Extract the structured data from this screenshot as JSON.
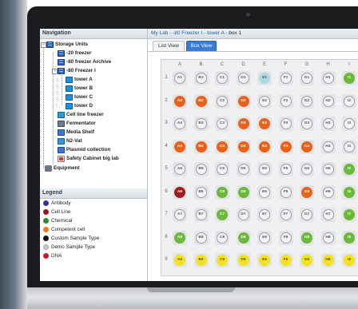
{
  "nav": {
    "header": "Navigation",
    "tree": [
      {
        "label": "Storage Units",
        "icon": "storage-units-icon",
        "type": "freezer"
      },
      {
        "label": "-20 freezer",
        "icon": "freezer-icon",
        "type": "freezer"
      },
      {
        "label": "-80 freezer Archive",
        "icon": "freezer-icon",
        "type": "freezer"
      },
      {
        "label": "-80 Freezer I",
        "icon": "freezer-icon",
        "type": "freezer"
      },
      {
        "label": "tower A",
        "icon": "tower-icon",
        "type": "tower"
      },
      {
        "label": "tower B",
        "icon": "tower-icon",
        "type": "tower"
      },
      {
        "label": "tower C",
        "icon": "tower-icon",
        "type": "tower"
      },
      {
        "label": "tower D",
        "icon": "tower-icon",
        "type": "tower"
      },
      {
        "label": "Cell line freezer",
        "icon": "freezer-icon",
        "type": "nitro"
      },
      {
        "label": "Fermentator",
        "icon": "fermentator-icon",
        "type": "ferm"
      },
      {
        "label": "Media Shelf",
        "icon": "shelf-icon",
        "type": "shelf"
      },
      {
        "label": "N2-Vat",
        "icon": "nitrogen-vat-icon",
        "type": "nitro"
      },
      {
        "label": "Plasmid collection",
        "icon": "freezer-icon",
        "type": "shelf"
      },
      {
        "label": "Safety Cabinet big lab",
        "icon": "cabinet-icon",
        "type": "cabinet"
      },
      {
        "label": "Equipment",
        "icon": "equipment-icon",
        "type": "gear"
      }
    ]
  },
  "legend": {
    "header": "Legend",
    "items": [
      {
        "label": "Antibody",
        "color": "#3b2f8f"
      },
      {
        "label": "Cell Line",
        "color": "#8f1c1c"
      },
      {
        "label": "Chemical",
        "color": "#2f8a2f"
      },
      {
        "label": "Competent cell",
        "color": "#f07a1a"
      },
      {
        "label": "Custom Sample Type",
        "color": "#111111"
      },
      {
        "label": "Demo Sample Type",
        "color": "#c9c9c9"
      },
      {
        "label": "DNA",
        "color": "#b8222a"
      }
    ]
  },
  "breadcrumb": {
    "items": [
      "My Lab",
      "-80 Freezer I",
      "tower A"
    ],
    "separator": "-",
    "current": "box 1"
  },
  "tabs": [
    {
      "label": "List View",
      "active": false
    },
    {
      "label": "Box View",
      "active": true
    }
  ],
  "box": {
    "columns": [
      "A",
      "B",
      "C",
      "D",
      "E",
      "F",
      "G",
      "H",
      "I"
    ],
    "rows": [
      "1",
      "2",
      "3",
      "4",
      "5",
      "6",
      "7",
      "8",
      "9"
    ],
    "well_colors": {
      "empty": "#f2f3f4",
      "orange": "#e8621c",
      "green": "#6cb83a",
      "red": "#a11d1d",
      "yellow": "#f3e21c",
      "teal": "#a8dbe6"
    },
    "wells": [
      [
        {
          "l": "A1",
          "c": "empty"
        },
        {
          "l": "B1",
          "c": "empty"
        },
        {
          "l": "C1",
          "c": "empty"
        },
        {
          "l": "D1",
          "c": "empty"
        },
        {
          "l": "E1",
          "c": "teal"
        },
        {
          "l": "F1",
          "c": "empty"
        },
        {
          "l": "G1",
          "c": "empty"
        },
        {
          "l": "H1",
          "c": "empty"
        },
        {
          "l": "I1",
          "c": "green"
        }
      ],
      [
        {
          "l": "A2",
          "c": "orange"
        },
        {
          "l": "B2",
          "c": "orange"
        },
        {
          "l": "C2",
          "c": "empty"
        },
        {
          "l": "D2",
          "c": "orange"
        },
        {
          "l": "E2",
          "c": "empty"
        },
        {
          "l": "F2",
          "c": "empty"
        },
        {
          "l": "G2",
          "c": "empty"
        },
        {
          "l": "H2",
          "c": "empty"
        },
        {
          "l": "I2",
          "c": "empty"
        }
      ],
      [
        {
          "l": "A3",
          "c": "empty"
        },
        {
          "l": "B3",
          "c": "empty"
        },
        {
          "l": "C3",
          "c": "empty"
        },
        {
          "l": "D3",
          "c": "orange"
        },
        {
          "l": "E3",
          "c": "orange"
        },
        {
          "l": "F3",
          "c": "empty"
        },
        {
          "l": "G3",
          "c": "empty"
        },
        {
          "l": "H3",
          "c": "empty"
        },
        {
          "l": "I3",
          "c": "empty"
        }
      ],
      [
        {
          "l": "A4",
          "c": "orange"
        },
        {
          "l": "B4",
          "c": "orange"
        },
        {
          "l": "C4",
          "c": "orange"
        },
        {
          "l": "D4",
          "c": "orange"
        },
        {
          "l": "E4",
          "c": "orange"
        },
        {
          "l": "F4",
          "c": "orange"
        },
        {
          "l": "G4",
          "c": "orange"
        },
        {
          "l": "H4",
          "c": "empty"
        },
        {
          "l": "I4",
          "c": "empty"
        }
      ],
      [
        {
          "l": "A5",
          "c": "empty"
        },
        {
          "l": "B5",
          "c": "empty"
        },
        {
          "l": "C5",
          "c": "empty"
        },
        {
          "l": "D5",
          "c": "empty"
        },
        {
          "l": "E5",
          "c": "empty"
        },
        {
          "l": "F5",
          "c": "empty"
        },
        {
          "l": "G5",
          "c": "empty"
        },
        {
          "l": "H5",
          "c": "empty"
        },
        {
          "l": "I5",
          "c": "green"
        }
      ],
      [
        {
          "l": "A6",
          "c": "red"
        },
        {
          "l": "B6",
          "c": "empty"
        },
        {
          "l": "C6",
          "c": "green"
        },
        {
          "l": "D6",
          "c": "green"
        },
        {
          "l": "E6",
          "c": "empty"
        },
        {
          "l": "F6",
          "c": "empty"
        },
        {
          "l": "G6",
          "c": "orange"
        },
        {
          "l": "H6",
          "c": "empty"
        },
        {
          "l": "I6",
          "c": "green"
        }
      ],
      [
        {
          "l": "A7",
          "c": "empty"
        },
        {
          "l": "B7",
          "c": "empty"
        },
        {
          "l": "C7",
          "c": "green"
        },
        {
          "l": "D7",
          "c": "empty"
        },
        {
          "l": "E7",
          "c": "empty"
        },
        {
          "l": "F7",
          "c": "empty"
        },
        {
          "l": "G7",
          "c": "empty"
        },
        {
          "l": "H7",
          "c": "empty"
        },
        {
          "l": "I7",
          "c": "green"
        }
      ],
      [
        {
          "l": "A8",
          "c": "green"
        },
        {
          "l": "B8",
          "c": "empty"
        },
        {
          "l": "C8",
          "c": "empty"
        },
        {
          "l": "D8",
          "c": "green"
        },
        {
          "l": "E8",
          "c": "empty"
        },
        {
          "l": "F8",
          "c": "empty"
        },
        {
          "l": "G8",
          "c": "green"
        },
        {
          "l": "H8",
          "c": "empty"
        },
        {
          "l": "I8",
          "c": "green"
        }
      ],
      [
        {
          "l": "A9",
          "c": "yellow"
        },
        {
          "l": "B9",
          "c": "yellow"
        },
        {
          "l": "C9",
          "c": "yellow"
        },
        {
          "l": "D9",
          "c": "yellow"
        },
        {
          "l": "E9",
          "c": "yellow"
        },
        {
          "l": "F9",
          "c": "yellow"
        },
        {
          "l": "G9",
          "c": "yellow"
        },
        {
          "l": "H9",
          "c": "yellow"
        },
        {
          "l": "I9",
          "c": "yellow"
        }
      ]
    ]
  }
}
